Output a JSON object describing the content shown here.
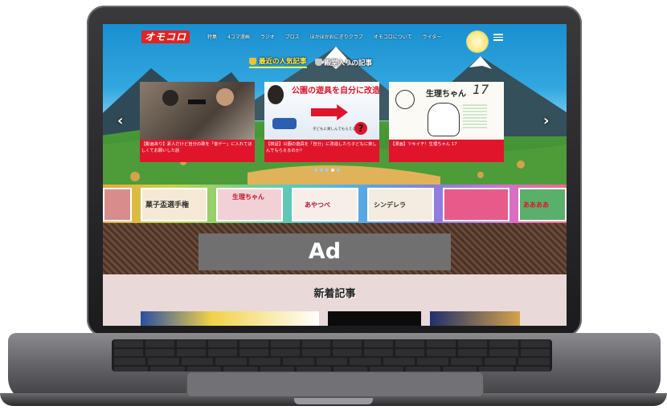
{
  "site": {
    "logo": "オモコロ",
    "nav": [
      "特集",
      "4コマ漫画",
      "ラジオ",
      "ブロス",
      "ほかほかおにぎりクラブ",
      "オモコロについて",
      "ライター"
    ],
    "tabs": [
      {
        "label": "最近の人気記事",
        "active": true
      },
      {
        "label": "殿堂入りの記事",
        "active": false
      }
    ],
    "carousel": {
      "prev": "‹",
      "next": "›",
      "cards": [
        {
          "caption": "【動画あり】素人だけど自分の歌を「音ゲー」に入れてほしくてお願いした話"
        },
        {
          "caption": "【検証】公園の遊具を「自分」に改造したら子どもに楽しんでもらえるのか？",
          "headline": "公園の遊具を自分に改造したら",
          "subtext": "子どもに楽しんでもらえるのか"
        },
        {
          "caption": "【漫画】ツキイチ！生理ちゃん 17",
          "headline": "生理ちゃん",
          "number": "17"
        }
      ],
      "dots": 5,
      "active_dot": 3
    },
    "thumbs": [
      {
        "text": ""
      },
      {
        "text": "菓子盃選手権"
      },
      {
        "text": "生理ちゃん"
      },
      {
        "text": "あやつべ"
      },
      {
        "text": "シンデレラ"
      },
      {
        "text": ""
      },
      {
        "text": "ああああ"
      }
    ],
    "ad_label": "Ad",
    "new_section_title": "新着記事"
  },
  "colors": {
    "logo_red": "#e32222",
    "caption_red": "#e0152b",
    "tab_active": "#fff04a",
    "ad_gray": "#707070"
  }
}
